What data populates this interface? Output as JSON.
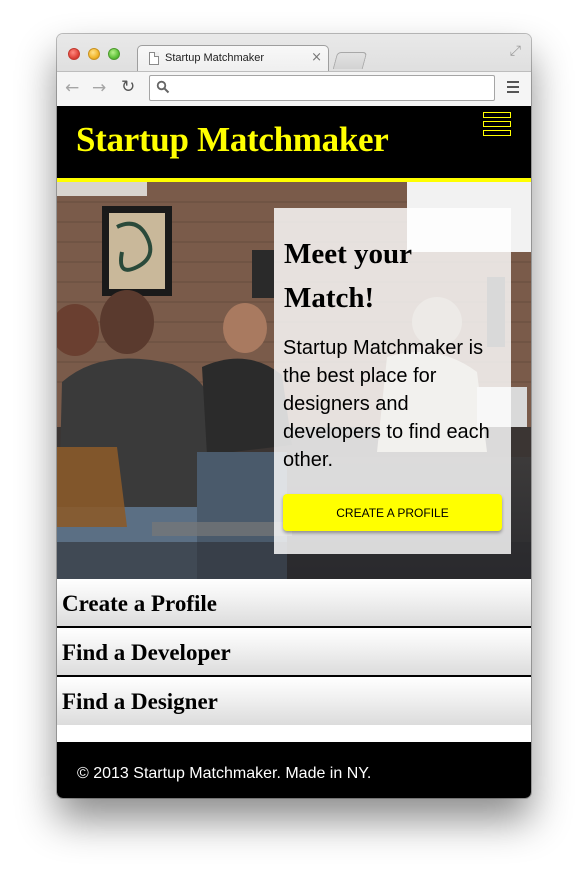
{
  "browser": {
    "tab_title": "Startup Matchmaker",
    "tab_close": "×",
    "url_value": "",
    "icons": {
      "back": "arrow-left-icon",
      "forward": "arrow-right-icon",
      "reload": "reload-icon",
      "search": "search-icon",
      "menu": "menu-icon",
      "resize": "fullscreen-icon"
    }
  },
  "header": {
    "title": "Startup Matchmaker",
    "brand_color": "#ffff00",
    "background": "#000000"
  },
  "hero": {
    "heading": "Meet your Match!",
    "text": "Startup Matchmaker is the best place for designers and developers to find each other.",
    "cta_label": "CREATE A PROFILE"
  },
  "nav": {
    "items": [
      {
        "label": "Create a Profile"
      },
      {
        "label": "Find a Developer"
      },
      {
        "label": "Find a Designer"
      }
    ]
  },
  "footer": {
    "text": "© 2013 Startup Matchmaker. Made in NY."
  }
}
